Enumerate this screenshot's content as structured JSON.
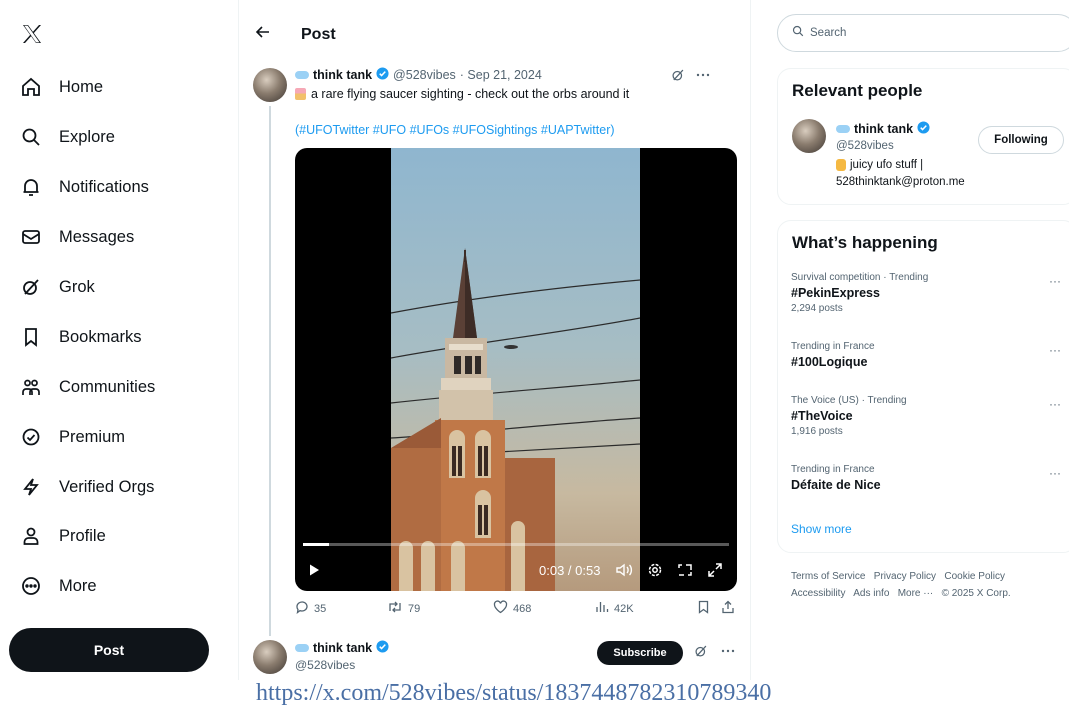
{
  "nav": {
    "items": [
      {
        "label": "Home",
        "icon": "home-icon"
      },
      {
        "label": "Explore",
        "icon": "search-icon"
      },
      {
        "label": "Notifications",
        "icon": "bell-icon"
      },
      {
        "label": "Messages",
        "icon": "envelope-icon"
      },
      {
        "label": "Grok",
        "icon": "grok-icon"
      },
      {
        "label": "Bookmarks",
        "icon": "bookmark-icon"
      },
      {
        "label": "Communities",
        "icon": "communities-icon"
      },
      {
        "label": "Premium",
        "icon": "premium-icon"
      },
      {
        "label": "Verified Orgs",
        "icon": "lightning-icon"
      },
      {
        "label": "Profile",
        "icon": "person-icon"
      },
      {
        "label": "More",
        "icon": "more-circle-icon"
      }
    ],
    "post_label": "Post"
  },
  "header": {
    "title": "Post"
  },
  "tweet": {
    "name": "think tank",
    "handle": "@528vibes",
    "date": "· Sep 21, 2024",
    "text": "a rare flying saucer sighting - check out the orbs around it",
    "hashtags": "(#UFOTwitter #UFO #UFOs #UFOSightings #UAPTwitter)",
    "video": {
      "time": "0:03 / 0:53",
      "progress": 0.06
    },
    "stats": {
      "replies": "35",
      "reposts": "79",
      "likes": "468",
      "views": "42K"
    }
  },
  "reply": {
    "name": "think tank",
    "handle": "@528vibes",
    "subscribe_label": "Subscribe"
  },
  "search": {
    "placeholder": "Search"
  },
  "relevant": {
    "title": "Relevant people",
    "name": "think tank",
    "handle": "@528vibes",
    "bio_line1": "juicy ufo stuff |",
    "bio_line2": "528thinktank@proton.me",
    "follow_label": "Following"
  },
  "happening": {
    "title": "What’s happening",
    "trends": [
      {
        "context": "Survival competition · Trending",
        "tag": "#PekinExpress",
        "count": "2,294 posts"
      },
      {
        "context": "Trending in France",
        "tag": "#100Logique",
        "count": ""
      },
      {
        "context": "The Voice (US) · Trending",
        "tag": "#TheVoice",
        "count": "1,916 posts"
      },
      {
        "context": "Trending in France",
        "tag": "Défaite de Nice",
        "count": ""
      }
    ],
    "more_glyph": "···",
    "show_more": "Show more"
  },
  "footer": {
    "line1": "Terms of Service   Privacy Policy   Cookie Policy",
    "line2": "Accessibility   Ads info   More ···   © 2025 X Corp."
  },
  "source_url": "https://x.com/528vibes/status/1837448782310789340",
  "colors": {
    "accent": "#1d9bf0",
    "text": "#0f1419",
    "muted": "#536471",
    "border": "#eff3f4"
  }
}
